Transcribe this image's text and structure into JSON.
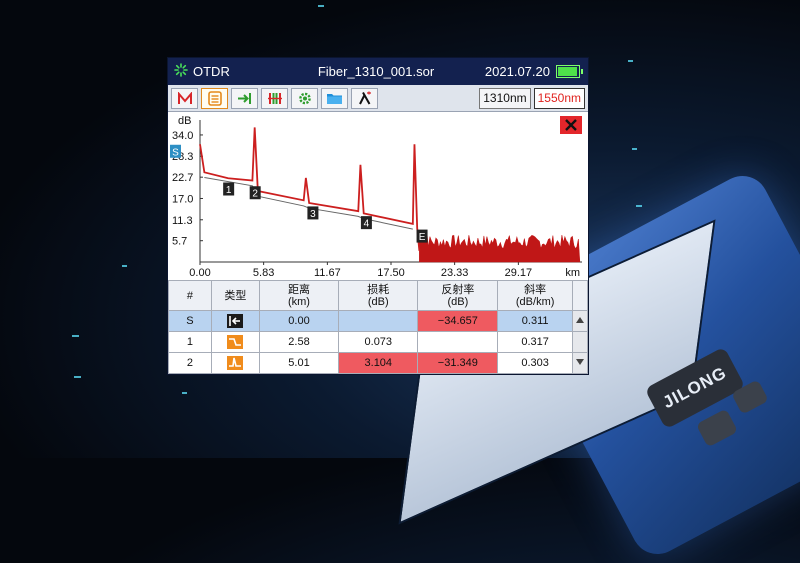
{
  "header": {
    "app_name": "OTDR",
    "file_name": "Fiber_1310_001.sor",
    "date": "2021.07.20",
    "battery_level": 1.0
  },
  "tabs": [
    {
      "icon": "trace-m-icon",
      "active": false
    },
    {
      "icon": "event-list-icon",
      "active": true
    },
    {
      "icon": "marker-arrow-icon",
      "active": false
    },
    {
      "icon": "splice-bars-icon",
      "active": false
    },
    {
      "icon": "settings-gear-icon",
      "active": false
    },
    {
      "icon": "folder-icon",
      "active": false
    },
    {
      "icon": "lambda-icon",
      "active": false
    }
  ],
  "wavelengths": {
    "w1310": "1310nm",
    "w1550": "1550nm",
    "selected": "1550nm"
  },
  "chart_data": {
    "type": "line",
    "ylabel": "dB",
    "xlabel": "km",
    "y_ticks": [
      "34.0",
      "28.3",
      "22.7",
      "17.0",
      "11.3",
      "5.7"
    ],
    "x_ticks": [
      "0.00",
      "5.83",
      "11.67",
      "17.50",
      "23.33",
      "29.17"
    ],
    "xlim": [
      0,
      35
    ],
    "ylim": [
      0,
      38
    ],
    "trace": [
      {
        "x": 0,
        "y": 31.5
      },
      {
        "x": 0.4,
        "y": 24.0
      },
      {
        "x": 2.58,
        "y": 22.4
      },
      {
        "x": 4.8,
        "y": 21.8
      },
      {
        "x": 5.01,
        "y": 36.0
      },
      {
        "x": 5.3,
        "y": 19.0
      },
      {
        "x": 9.5,
        "y": 16.5
      },
      {
        "x": 9.7,
        "y": 22.5
      },
      {
        "x": 10.0,
        "y": 15.8
      },
      {
        "x": 14.5,
        "y": 13.6
      },
      {
        "x": 14.7,
        "y": 26.0
      },
      {
        "x": 15.0,
        "y": 13.0
      },
      {
        "x": 19.5,
        "y": 10.2
      },
      {
        "x": 19.65,
        "y": 31.5
      },
      {
        "x": 19.9,
        "y": 9.0
      },
      {
        "x": 20.1,
        "y": 3.0
      }
    ],
    "noise_start_km": 20.1,
    "noise_end_km": 34.8,
    "noise_level_db": 3.5,
    "colors": {
      "trace": "#cc1f1f",
      "baseline": "#666666",
      "noise": "#c01717"
    },
    "events": [
      {
        "label": "S",
        "x": 0.0,
        "y": 29.5
      },
      {
        "label": "1",
        "x": 2.58,
        "y": 19.4
      },
      {
        "label": "2",
        "x": 5.01,
        "y": 18.4
      },
      {
        "label": "3",
        "x": 10.3,
        "y": 13.0
      },
      {
        "label": "4",
        "x": 15.2,
        "y": 10.4
      },
      {
        "label": "E",
        "x": 20.3,
        "y": 6.8
      }
    ],
    "close_icon": "close-x-icon"
  },
  "table": {
    "headers": [
      {
        "l1": "#",
        "l2": ""
      },
      {
        "l1": "类型",
        "l2": ""
      },
      {
        "l1": "距离",
        "l2": "(km)"
      },
      {
        "l1": "损耗",
        "l2": "(dB)"
      },
      {
        "l1": "反射率",
        "l2": "(dB)"
      },
      {
        "l1": "斜率",
        "l2": "(dB/km)"
      }
    ],
    "rows": [
      {
        "no": "S",
        "type_icon": "start-event-icon",
        "distance": "0.00",
        "loss": "",
        "reflect": "−34.657",
        "slope": "0.311",
        "selected": true,
        "hl": [
          "reflect"
        ]
      },
      {
        "no": "1",
        "type_icon": "nonreflective-event-icon",
        "distance": "2.58",
        "loss": "0.073",
        "reflect": "",
        "slope": "0.317",
        "selected": false,
        "hl": []
      },
      {
        "no": "2",
        "type_icon": "reflective-event-icon",
        "distance": "5.01",
        "loss": "3.104",
        "reflect": "−31.349",
        "slope": "0.303",
        "selected": false,
        "hl": [
          "loss",
          "reflect"
        ]
      }
    ]
  },
  "device": {
    "brand": "JILONG"
  },
  "colors": {
    "header_bg": "#13214f",
    "highlight_red": "#ef5a60",
    "selected_row": "#b9d3f0",
    "accent_orange": "#f08c1c"
  }
}
